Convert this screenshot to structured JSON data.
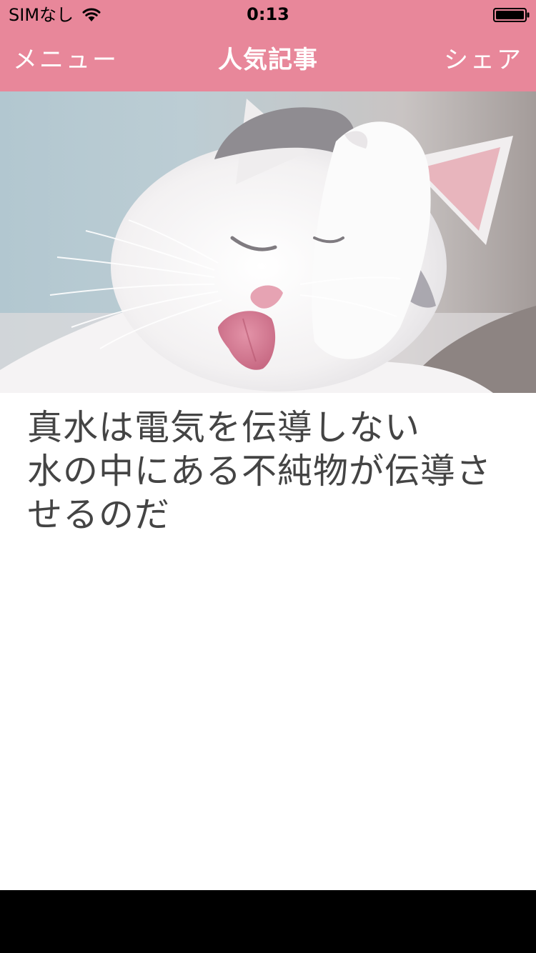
{
  "status_bar": {
    "carrier": "SIMなし",
    "time": "0:13",
    "wifi_icon": "wifi-icon",
    "battery_icon": "battery-full-icon"
  },
  "nav": {
    "left_label": "メニュー",
    "title": "人気記事",
    "right_label": "シェア",
    "background_color": "#e8879a"
  },
  "article": {
    "image_subject": "cat-photo",
    "lines": [
      "真水は電気を伝導しない",
      "水の中にある不純物が伝導さ",
      "せるのだ"
    ]
  }
}
